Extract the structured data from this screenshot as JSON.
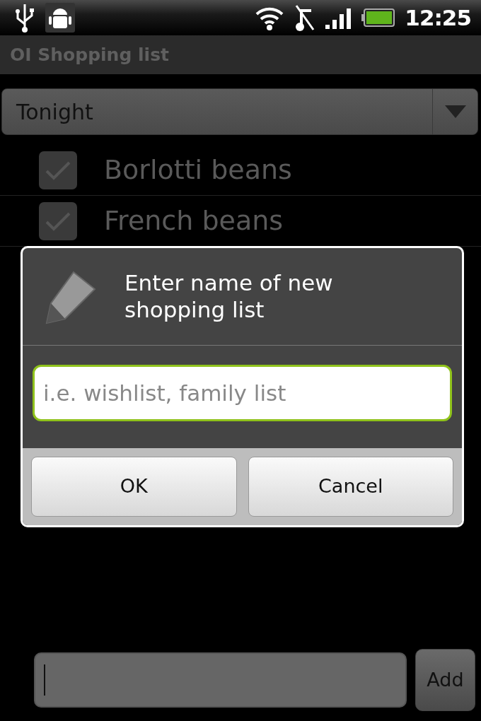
{
  "status_bar": {
    "time": "12:25"
  },
  "title_bar": {
    "title": "OI Shopping list"
  },
  "list_selector": {
    "value": "Tonight"
  },
  "items": [
    {
      "name": "Borlotti beans",
      "checked": true
    },
    {
      "name": "French beans",
      "checked": true
    }
  ],
  "dialog": {
    "title": "Enter name of new shopping list",
    "input": {
      "placeholder": "i.e. wishlist, family list"
    },
    "buttons": [
      "OK",
      "Cancel"
    ]
  },
  "add_bar": {
    "button": "Add"
  }
}
